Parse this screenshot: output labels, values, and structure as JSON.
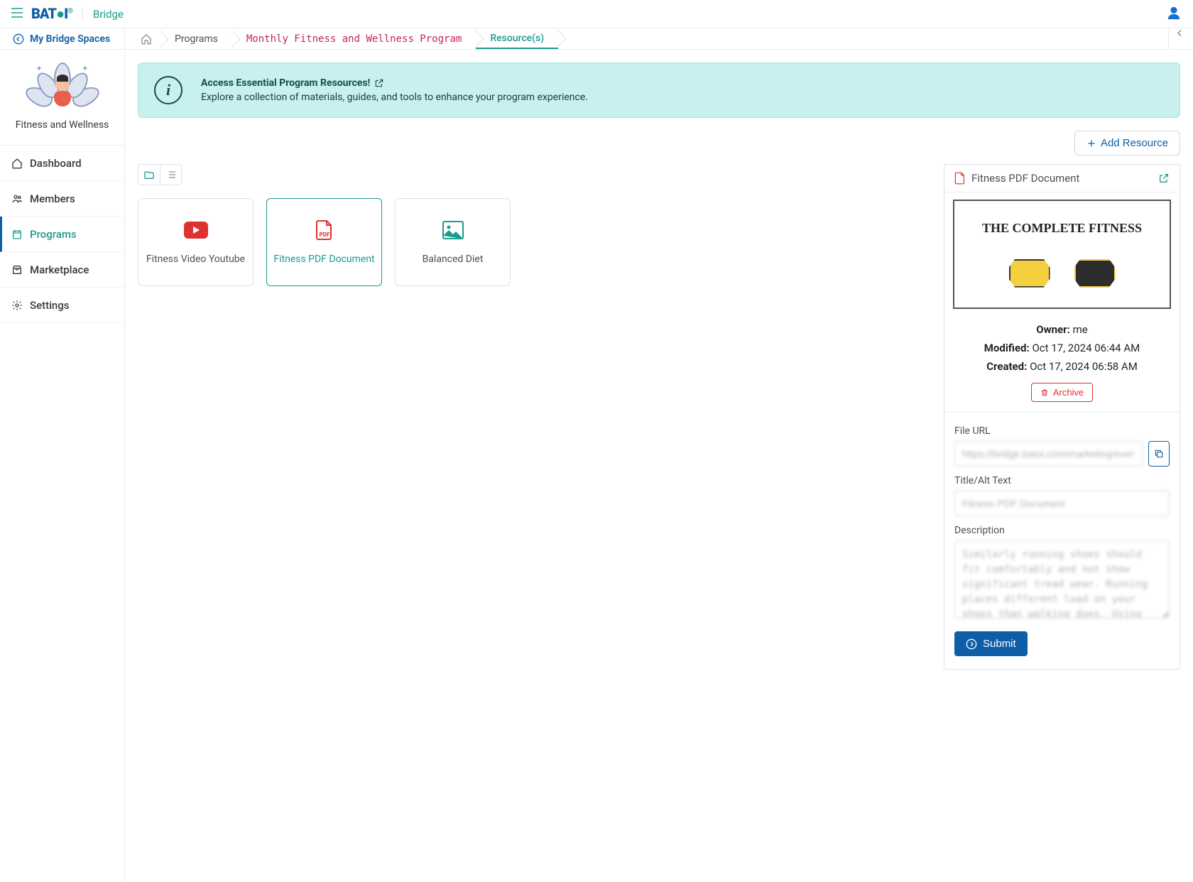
{
  "topbar": {
    "logo_main": "BAT",
    "logo_tail": "I",
    "product": "Bridge"
  },
  "breadcrumb": {
    "back_label": "My Bridge Spaces",
    "items": [
      "Programs",
      "Monthly Fitness and Wellness Program",
      "Resource(s)"
    ]
  },
  "sidebar": {
    "space_name": "Fitness and Wellness",
    "items": [
      {
        "label": "Dashboard"
      },
      {
        "label": "Members"
      },
      {
        "label": "Programs"
      },
      {
        "label": "Marketplace"
      },
      {
        "label": "Settings"
      }
    ]
  },
  "banner": {
    "title": "Access Essential Program Resources!",
    "subtitle": "Explore a collection of materials, guides, and tools to enhance your program experience."
  },
  "toolbar": {
    "add_label": "Add Resource"
  },
  "cards": [
    {
      "label": "Fitness Video Youtube",
      "type": "youtube"
    },
    {
      "label": "Fitness PDF Document",
      "type": "pdf"
    },
    {
      "label": "Balanced Diet",
      "type": "image"
    }
  ],
  "detail": {
    "title": "Fitness PDF Document",
    "preview_heading": "THE COMPLETE FITNESS",
    "owner_label": "Owner:",
    "owner_value": "me",
    "modified_label": "Modified:",
    "modified_value": "Oct 17, 2024 06:44 AM",
    "created_label": "Created:",
    "created_value": "Oct 17, 2024 06:58 AM",
    "archive_label": "Archive",
    "form": {
      "url_label": "File URL",
      "url_value": "https://bridge.batoi.com/marketing/event/resource",
      "title_label": "Title/Alt Text",
      "title_value": "Fitness PDF Document",
      "desc_label": "Description",
      "desc_value": "Similarly running shoes should fit comfortably and not show significant tread wear. Running places different load on your shoes than walking does. Using shoes you walk in for running can place undue stress on your lower body. The stress can increase the risk of injury.",
      "submit_label": "Submit"
    }
  }
}
